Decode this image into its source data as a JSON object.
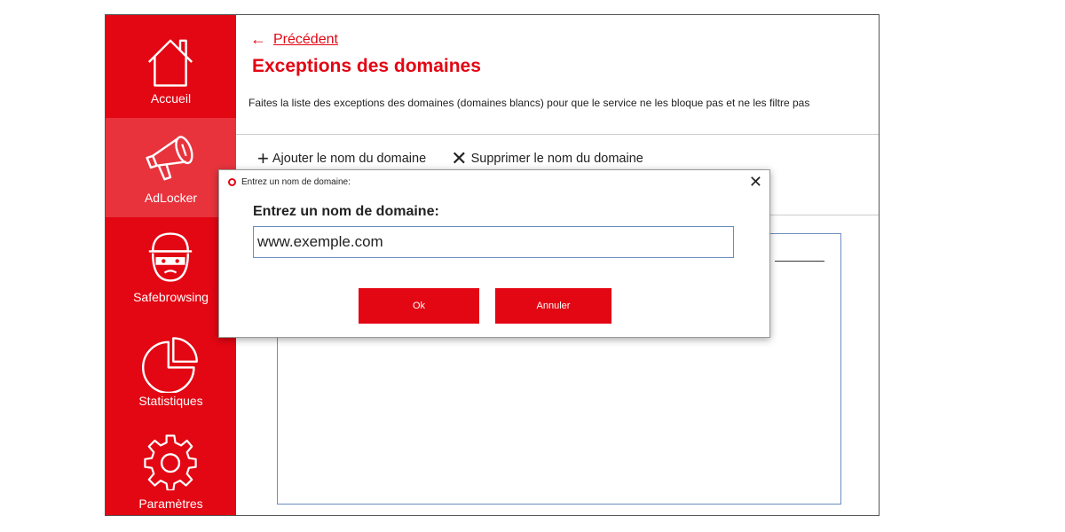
{
  "sidebar": {
    "items": [
      {
        "label": "Accueil",
        "icon": "home-icon",
        "active": false
      },
      {
        "label": "AdLocker",
        "icon": "megaphone-icon",
        "active": true
      },
      {
        "label": "Safebrowsing",
        "icon": "masked-bandit-icon",
        "active": false
      },
      {
        "label": "Statistiques",
        "icon": "pie-chart-icon",
        "active": false
      },
      {
        "label": "Paramètres",
        "icon": "gear-icon",
        "active": false
      }
    ]
  },
  "main": {
    "back_label": "Précédent",
    "title": "Exceptions des domaines",
    "description": "Faites la liste des exceptions des domaines (domaines blancs) pour que le service ne les bloque pas et ne les filtre pas",
    "toolbar": {
      "add_label": "Ajouter le nom du domaine",
      "remove_label": "Supprimer le nom du domaine"
    }
  },
  "dialog": {
    "window_title": "Entrez un nom de domaine:",
    "prompt": "Entrez un nom de domaine:",
    "input_value": "www.exemple.com",
    "ok_label": "Ok",
    "cancel_label": "Annuler"
  },
  "colors": {
    "brand_red": "#e30613",
    "active_nav": "#e8333d",
    "input_border": "#6c8ebf"
  }
}
